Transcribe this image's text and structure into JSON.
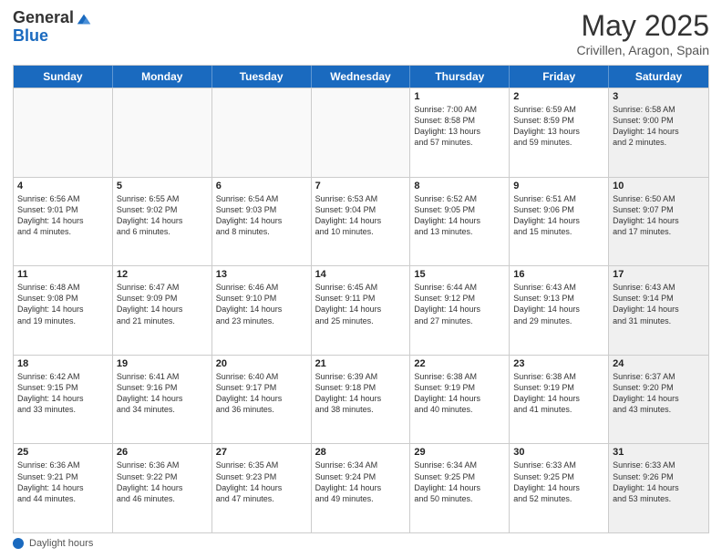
{
  "logo": {
    "general": "General",
    "blue": "Blue"
  },
  "title": "May 2025",
  "location": "Crivillen, Aragon, Spain",
  "day_headers": [
    "Sunday",
    "Monday",
    "Tuesday",
    "Wednesday",
    "Thursday",
    "Friday",
    "Saturday"
  ],
  "footer_label": "Daylight hours",
  "weeks": [
    [
      {
        "num": "",
        "info": "",
        "empty": true
      },
      {
        "num": "",
        "info": "",
        "empty": true
      },
      {
        "num": "",
        "info": "",
        "empty": true
      },
      {
        "num": "",
        "info": "",
        "empty": true
      },
      {
        "num": "1",
        "info": "Sunrise: 7:00 AM\nSunset: 8:58 PM\nDaylight: 13 hours\nand 57 minutes."
      },
      {
        "num": "2",
        "info": "Sunrise: 6:59 AM\nSunset: 8:59 PM\nDaylight: 13 hours\nand 59 minutes."
      },
      {
        "num": "3",
        "info": "Sunrise: 6:58 AM\nSunset: 9:00 PM\nDaylight: 14 hours\nand 2 minutes.",
        "shaded": true
      }
    ],
    [
      {
        "num": "4",
        "info": "Sunrise: 6:56 AM\nSunset: 9:01 PM\nDaylight: 14 hours\nand 4 minutes."
      },
      {
        "num": "5",
        "info": "Sunrise: 6:55 AM\nSunset: 9:02 PM\nDaylight: 14 hours\nand 6 minutes."
      },
      {
        "num": "6",
        "info": "Sunrise: 6:54 AM\nSunset: 9:03 PM\nDaylight: 14 hours\nand 8 minutes."
      },
      {
        "num": "7",
        "info": "Sunrise: 6:53 AM\nSunset: 9:04 PM\nDaylight: 14 hours\nand 10 minutes."
      },
      {
        "num": "8",
        "info": "Sunrise: 6:52 AM\nSunset: 9:05 PM\nDaylight: 14 hours\nand 13 minutes."
      },
      {
        "num": "9",
        "info": "Sunrise: 6:51 AM\nSunset: 9:06 PM\nDaylight: 14 hours\nand 15 minutes."
      },
      {
        "num": "10",
        "info": "Sunrise: 6:50 AM\nSunset: 9:07 PM\nDaylight: 14 hours\nand 17 minutes.",
        "shaded": true
      }
    ],
    [
      {
        "num": "11",
        "info": "Sunrise: 6:48 AM\nSunset: 9:08 PM\nDaylight: 14 hours\nand 19 minutes."
      },
      {
        "num": "12",
        "info": "Sunrise: 6:47 AM\nSunset: 9:09 PM\nDaylight: 14 hours\nand 21 minutes."
      },
      {
        "num": "13",
        "info": "Sunrise: 6:46 AM\nSunset: 9:10 PM\nDaylight: 14 hours\nand 23 minutes."
      },
      {
        "num": "14",
        "info": "Sunrise: 6:45 AM\nSunset: 9:11 PM\nDaylight: 14 hours\nand 25 minutes."
      },
      {
        "num": "15",
        "info": "Sunrise: 6:44 AM\nSunset: 9:12 PM\nDaylight: 14 hours\nand 27 minutes."
      },
      {
        "num": "16",
        "info": "Sunrise: 6:43 AM\nSunset: 9:13 PM\nDaylight: 14 hours\nand 29 minutes."
      },
      {
        "num": "17",
        "info": "Sunrise: 6:43 AM\nSunset: 9:14 PM\nDaylight: 14 hours\nand 31 minutes.",
        "shaded": true
      }
    ],
    [
      {
        "num": "18",
        "info": "Sunrise: 6:42 AM\nSunset: 9:15 PM\nDaylight: 14 hours\nand 33 minutes."
      },
      {
        "num": "19",
        "info": "Sunrise: 6:41 AM\nSunset: 9:16 PM\nDaylight: 14 hours\nand 34 minutes."
      },
      {
        "num": "20",
        "info": "Sunrise: 6:40 AM\nSunset: 9:17 PM\nDaylight: 14 hours\nand 36 minutes."
      },
      {
        "num": "21",
        "info": "Sunrise: 6:39 AM\nSunset: 9:18 PM\nDaylight: 14 hours\nand 38 minutes."
      },
      {
        "num": "22",
        "info": "Sunrise: 6:38 AM\nSunset: 9:19 PM\nDaylight: 14 hours\nand 40 minutes."
      },
      {
        "num": "23",
        "info": "Sunrise: 6:38 AM\nSunset: 9:19 PM\nDaylight: 14 hours\nand 41 minutes."
      },
      {
        "num": "24",
        "info": "Sunrise: 6:37 AM\nSunset: 9:20 PM\nDaylight: 14 hours\nand 43 minutes.",
        "shaded": true
      }
    ],
    [
      {
        "num": "25",
        "info": "Sunrise: 6:36 AM\nSunset: 9:21 PM\nDaylight: 14 hours\nand 44 minutes."
      },
      {
        "num": "26",
        "info": "Sunrise: 6:36 AM\nSunset: 9:22 PM\nDaylight: 14 hours\nand 46 minutes."
      },
      {
        "num": "27",
        "info": "Sunrise: 6:35 AM\nSunset: 9:23 PM\nDaylight: 14 hours\nand 47 minutes."
      },
      {
        "num": "28",
        "info": "Sunrise: 6:34 AM\nSunset: 9:24 PM\nDaylight: 14 hours\nand 49 minutes."
      },
      {
        "num": "29",
        "info": "Sunrise: 6:34 AM\nSunset: 9:25 PM\nDaylight: 14 hours\nand 50 minutes."
      },
      {
        "num": "30",
        "info": "Sunrise: 6:33 AM\nSunset: 9:25 PM\nDaylight: 14 hours\nand 52 minutes."
      },
      {
        "num": "31",
        "info": "Sunrise: 6:33 AM\nSunset: 9:26 PM\nDaylight: 14 hours\nand 53 minutes.",
        "shaded": true
      }
    ]
  ]
}
